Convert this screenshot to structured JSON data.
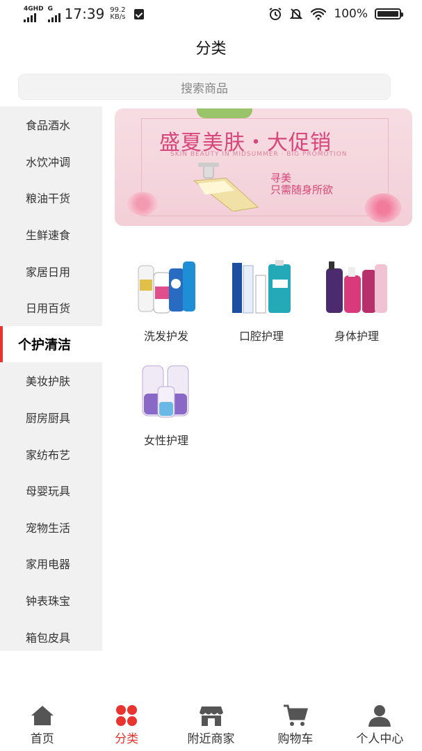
{
  "status_bar": {
    "network_top": "4GHD",
    "network_g": "G",
    "time": "17:39",
    "speed_value": "99.2",
    "speed_unit": "KB/s",
    "battery": "100%"
  },
  "header": {
    "title": "分类",
    "search_placeholder": "搜索商品"
  },
  "sidebar": {
    "items": [
      {
        "label": "食品酒水"
      },
      {
        "label": "水饮冲调"
      },
      {
        "label": "粮油干货"
      },
      {
        "label": "生鲜速食"
      },
      {
        "label": "家居日用"
      },
      {
        "label": "日用百货"
      },
      {
        "label": "个护清洁"
      },
      {
        "label": "美妆护肤"
      },
      {
        "label": "厨房厨具"
      },
      {
        "label": "家纺布艺"
      },
      {
        "label": "母婴玩具"
      },
      {
        "label": "宠物生活"
      },
      {
        "label": "家用电器"
      },
      {
        "label": "钟表珠宝"
      },
      {
        "label": "箱包皮具"
      }
    ],
    "active_index": 6
  },
  "banner": {
    "title": "盛夏美肤・大促销",
    "subtitle": "SKIN BEAUTY IN MIDSUMMER · BIG PROMOTION",
    "line1": "寻美",
    "line2": "只需随身所欲",
    "colors": {
      "bg": "#f5d6de",
      "accent": "#d8457a"
    }
  },
  "categories": [
    {
      "label": "洗发护发",
      "icon": "shampoo-bottles-image"
    },
    {
      "label": "口腔护理",
      "icon": "toothpaste-image"
    },
    {
      "label": "身体护理",
      "icon": "body-wash-image"
    },
    {
      "label": "女性护理",
      "icon": "feminine-care-image"
    }
  ],
  "tabbar": {
    "items": [
      {
        "label": "首页",
        "icon": "home-icon"
      },
      {
        "label": "分类",
        "icon": "category-icon"
      },
      {
        "label": "附近商家",
        "icon": "store-icon"
      },
      {
        "label": "购物车",
        "icon": "cart-icon"
      },
      {
        "label": "个人中心",
        "icon": "user-icon"
      }
    ],
    "active_index": 1,
    "colors": {
      "active": "#e8332f",
      "inactive": "#555555"
    }
  }
}
